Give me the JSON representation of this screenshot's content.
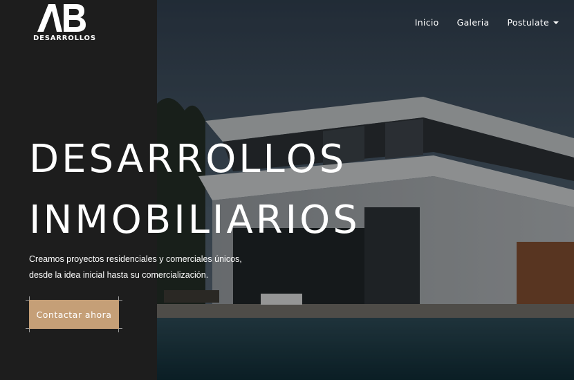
{
  "logo": {
    "mark": "AB",
    "text": "DESARROLLOS"
  },
  "nav": {
    "items": [
      {
        "label": "Inicio"
      },
      {
        "label": "Galeria"
      },
      {
        "label": "Postulate"
      }
    ]
  },
  "hero": {
    "title_line1": "DESARROLLOS",
    "title_line2": "INMOBILIARIOS",
    "subtitle_line1": "Creamos proyectos residenciales y comerciales únicos,",
    "subtitle_line2": "desde la idea inicial hasta su comercialización.",
    "cta_label": "Contactar ahora"
  },
  "colors": {
    "panel": "#1d1d1d",
    "accent": "#c59f77",
    "text": "#ffffff"
  }
}
